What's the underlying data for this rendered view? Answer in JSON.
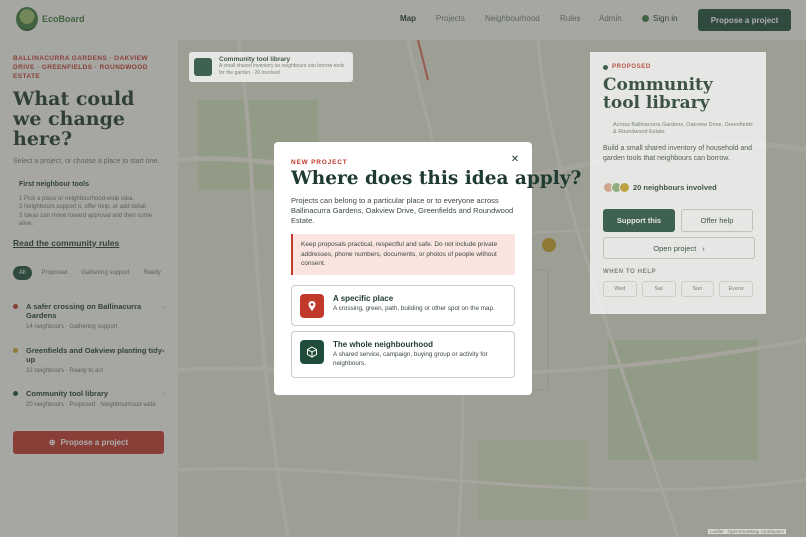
{
  "header": {
    "logo_text": "EcoBoard",
    "nav": [
      "Map",
      "Projects",
      "Neighbourhood",
      "Rules",
      "Admin"
    ],
    "active_nav": "Map",
    "signin": "Sign in",
    "propose": "Propose a project"
  },
  "sidebar": {
    "crumb": "BALLINACURRA GARDENS · OAKVIEW DRIVE · GREENFIELDS · ROUNDWOOD ESTATE",
    "title": "What could we change here?",
    "intro": "Select a project, or choose a place to start one.",
    "tools_title": "First neighbour tools",
    "tools": [
      "1 Pick a place or neighbourhood-wide idea.",
      "2 Neighbours support it, offer help, or add detail.",
      "3 Ideas can move toward approval and then come alive."
    ],
    "rules_link": "Read the community rules",
    "filters": [
      "All",
      "Proposed",
      "Gathering support",
      "Ready"
    ],
    "projects": [
      {
        "title": "A safer crossing on Ballinacurra Gardens",
        "meta": "14 neighbours · Gathering support",
        "color": "#c0392b"
      },
      {
        "title": "Greenfields and Oakview planting tidy-up",
        "meta": "22 neighbours · Ready to act",
        "color": "#c9a227"
      },
      {
        "title": "Community tool library",
        "meta": "20 neighbours · Proposed · Neighbourhood-wide",
        "color": "#1f4d3a"
      }
    ],
    "propose": "Propose a project"
  },
  "popup": {
    "title": "Community tool library",
    "text": "A small shared inventory so neighbours can borrow tools for the garden · 20 involved"
  },
  "card": {
    "badge": "PROPOSED",
    "title": "Community tool library",
    "location": "Across Ballinacurra Gardens, Oakview Drive, Greenfields & Roundwood Estate",
    "desc": "Build a small shared inventory of household and garden tools that neighbours can borrow.",
    "involved": "20 neighbours involved",
    "support": "Support this",
    "offer_help": "Offer help",
    "open": "Open project",
    "when_title": "WHEN TO HELP",
    "times": [
      "Wed",
      "Sat",
      "Sun",
      "Evens"
    ]
  },
  "attribution": "Leaflet · OpenStreetMap contributors",
  "modal": {
    "label": "New project",
    "title": "Where does this idea apply?",
    "desc": "Projects can belong to a particular place or to everyone across Ballinacurra Gardens, Oakview Drive, Greenfields and Roundwood Estate.",
    "note": "Keep proposals practical, respectful and safe. Do not include private addresses, phone numbers, documents, or photos of people without consent.",
    "options": [
      {
        "title": "A specific place",
        "text": "A crossing, green, path, building or other spot on the map.",
        "color": "#c0392b"
      },
      {
        "title": "The whole neighbourhood",
        "text": "A shared service, campaign, buying group or activity for neighbours.",
        "color": "#1f4d3a"
      }
    ]
  }
}
